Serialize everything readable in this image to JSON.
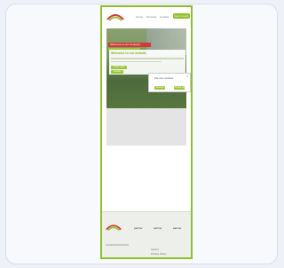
{
  "nav": {
    "links": [
      "Home",
      "Services",
      "Contact"
    ],
    "cta": "Get in touch"
  },
  "hero": {
    "banner": "Welcome to our company",
    "panel_title": "Welcome to our website",
    "panel_buttons": [
      "Learn more",
      "Contact"
    ]
  },
  "cookie": {
    "title": "We use cookies",
    "close": "×",
    "buttons": [
      "Settings",
      "Accept all"
    ]
  },
  "footer": {
    "partners": [
      "partner",
      "partner",
      "partner"
    ],
    "text_lines": [
      "Imprint",
      "Privacy Policy"
    ]
  },
  "colors": {
    "accent": "#8fbf2a",
    "banner_red": "#d23a34",
    "background": "#eef1f7"
  }
}
